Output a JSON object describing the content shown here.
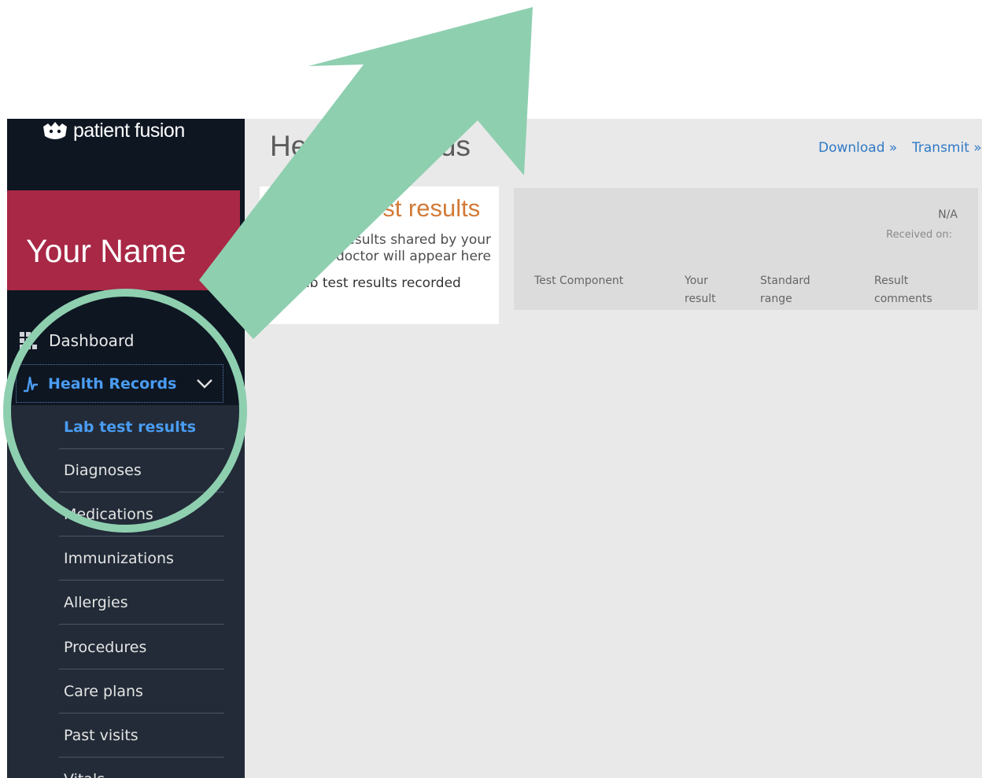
{
  "app": {
    "brand": "patient fusion",
    "user_name": "Your Name"
  },
  "sidebar": {
    "dashboard": {
      "label": "Dashboard",
      "icon": "grid-icon"
    },
    "health_records": {
      "label": "Health Records",
      "icon": "pulse-icon",
      "expanded_icon": "chevron-down-icon"
    },
    "sub_items": [
      {
        "label": "Lab test results",
        "active": true
      },
      {
        "label": "Diagnoses"
      },
      {
        "label": "Medications"
      },
      {
        "label": "Immunizations"
      },
      {
        "label": "Allergies"
      },
      {
        "label": "Procedures"
      },
      {
        "label": "Care plans"
      },
      {
        "label": "Past visits"
      },
      {
        "label": "Vitals"
      }
    ]
  },
  "main": {
    "title": "Health Records",
    "links": {
      "download": "Download »",
      "transmit": "Transmit »"
    },
    "card": {
      "title": "Lab test results",
      "description": "Lab results shared by your doctor will appear here",
      "empty_text": "No lab test results recorded"
    },
    "results": {
      "value": "N/A",
      "received_label": "Received on:",
      "columns": [
        [
          "Test Component"
        ],
        [
          "Your",
          "result"
        ],
        [
          "Standard",
          "range"
        ],
        [
          "Result",
          "comments"
        ]
      ]
    }
  },
  "colors": {
    "sidebar": "#0e1622",
    "banner": "#a82845",
    "active_link": "#4a9cf2",
    "annotation": "#8ecfb0",
    "card_title": "#d27a37"
  }
}
